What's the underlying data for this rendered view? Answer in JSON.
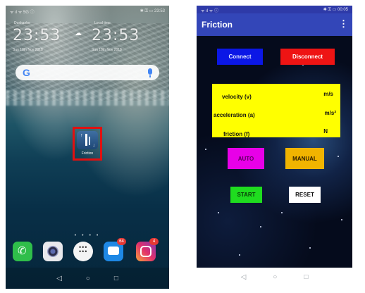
{
  "left_phone": {
    "status_left": "ᯤ ıl ᯤ 5G ⓘ",
    "status_right": "✱ ⚿ ▭ 23:53",
    "clocks": [
      {
        "label": "Dushanbe",
        "time": "23:53",
        "date": "Sun 18th Nov 2018"
      },
      {
        "label": "Local time",
        "time": "23:53",
        "date": "Sun 18th Nov 2018"
      }
    ],
    "weather_icon": "cloud-sun-icon",
    "search_bar": {
      "logo": "G",
      "mic_icon": "mic-icon"
    },
    "friction_app": {
      "label": "Friction",
      "icon": "friction-app-icon"
    },
    "page_dots": "• • • •",
    "dock": [
      {
        "name": "phone",
        "icon": "phone-icon",
        "badge": ""
      },
      {
        "name": "camera",
        "icon": "camera-icon",
        "badge": ""
      },
      {
        "name": "apps",
        "icon": "apps-grid-icon",
        "badge": ""
      },
      {
        "name": "messages",
        "icon": "message-icon",
        "badge": "64"
      },
      {
        "name": "instagram",
        "icon": "instagram-icon",
        "badge": "4"
      }
    ],
    "nav": {
      "back": "◁",
      "home": "○",
      "recents": "□"
    }
  },
  "right_phone": {
    "status_left": "ᯤ ıl ᯤ ⓘ",
    "status_right": "✱ ⚿ ▭ 00:05",
    "app_title": "Friction",
    "overflow_icon": "⋮",
    "buttons": {
      "connect": "Connect",
      "disconnect": "Disconnect",
      "auto": "AUTO",
      "manual": "MANUAL",
      "start": "START",
      "reset": "RESET"
    },
    "readouts": [
      {
        "label": "velocity (v)",
        "unit": "m/s"
      },
      {
        "label": "acceleration (a)",
        "unit": "m/s²"
      },
      {
        "label": "friction (f)",
        "unit": "N"
      }
    ],
    "nav": {
      "back": "◁",
      "home": "○",
      "recents": "□"
    }
  },
  "colors": {
    "app_bar": "#3346b8",
    "connect": "#0b17e6",
    "disconnect": "#ee1414",
    "auto": "#e800e8",
    "manual": "#f1b400",
    "start": "#1fdc1f",
    "reset": "#ffffff",
    "readout_panel": "#ffff00",
    "highlight_box": "#e01010"
  }
}
